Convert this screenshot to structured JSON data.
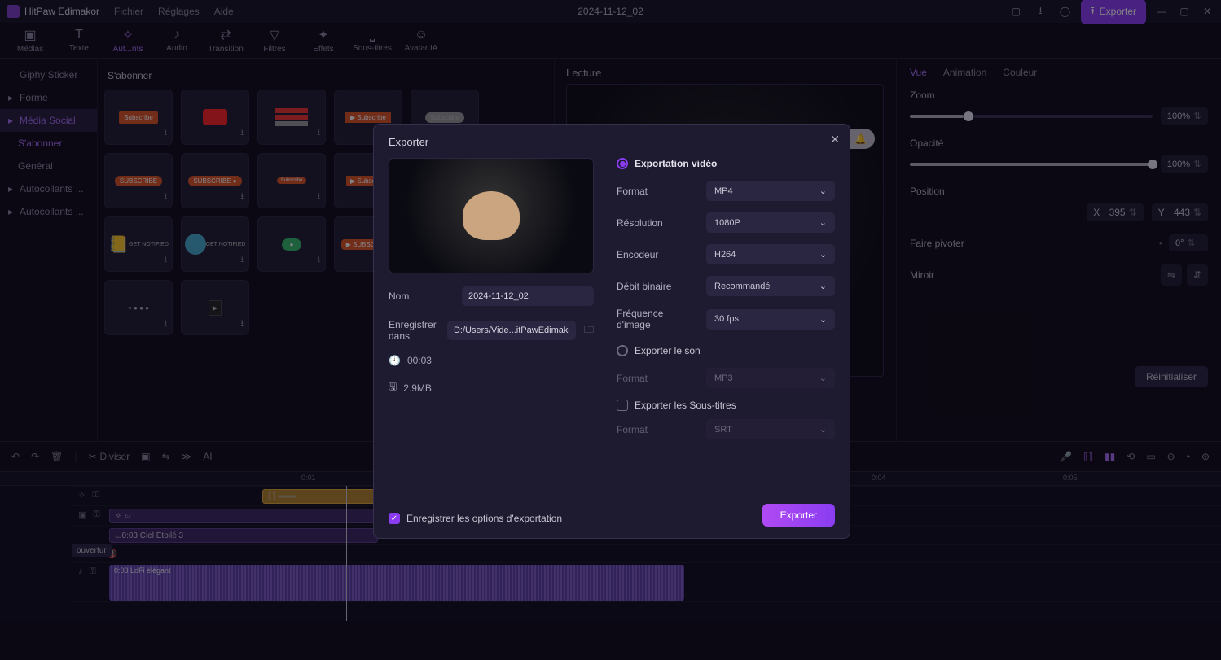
{
  "app": {
    "name": "HitPaw Edimakor",
    "file": "2024-11-12_02",
    "menus": [
      "Fichier",
      "Réglages",
      "Aide"
    ],
    "export_btn": "Exporter"
  },
  "tools": [
    {
      "label": "Médias",
      "active": false
    },
    {
      "label": "Texte",
      "active": false
    },
    {
      "label": "Aut...nts",
      "active": true
    },
    {
      "label": "Audio",
      "active": false
    },
    {
      "label": "Transition",
      "active": false
    },
    {
      "label": "Filtres",
      "active": false
    },
    {
      "label": "Effets",
      "active": false
    },
    {
      "label": "Sous-titres",
      "active": false
    },
    {
      "label": "Avatar IA",
      "active": false
    }
  ],
  "sidebar": {
    "items": [
      {
        "label": "Giphy Sticker",
        "chev": false
      },
      {
        "label": "Forme",
        "chev": true
      },
      {
        "label": "Média Social",
        "chev": true,
        "active": true
      },
      {
        "label": "S'abonner",
        "chev": false,
        "indent": true,
        "active": true
      },
      {
        "label": "Général",
        "chev": false,
        "indent": true
      },
      {
        "label": "Autocollants ...",
        "chev": true
      },
      {
        "label": "Autocollants ...",
        "chev": true
      }
    ],
    "section_title": "S'abonner"
  },
  "preview": {
    "title": "Lecture"
  },
  "right_tabs": [
    {
      "label": "Vue",
      "active": true
    },
    {
      "label": "Animation"
    },
    {
      "label": "Couleur"
    }
  ],
  "props": {
    "zoom": {
      "label": "Zoom",
      "value": "100%",
      "pct": 22
    },
    "opacity": {
      "label": "Opacité",
      "value": "100%",
      "pct": 100
    },
    "position": {
      "label": "Position",
      "x_label": "X",
      "x": "395",
      "y_label": "Y",
      "y": "443"
    },
    "rotate": {
      "label": "Faire pivoter",
      "value": "0°"
    },
    "mirror": {
      "label": "Miroir"
    },
    "reset": "Réinitialiser"
  },
  "tl": {
    "split": "Diviser",
    "ticks": [
      "0:01",
      "0:04",
      "0:05"
    ],
    "clip_label": "0:03 Ciel Étoilé 3",
    "audio_label": "0:03 LoFi élégant",
    "transition": "ouvertur"
  },
  "modal": {
    "title": "Exporter",
    "video_export": "Exportation vidéo",
    "name_label": "Nom",
    "name_value": "2024-11-12_02",
    "save_label": "Enregistrer dans",
    "save_path": "D:/Users/Vide...itPawEdimakor",
    "duration": "00:03",
    "size": "2.9MB",
    "format_label": "Format",
    "format_value": "MP4",
    "res_label": "Résolution",
    "res_value": "1080P",
    "enc_label": "Encodeur",
    "enc_value": "H264",
    "bitrate_label": "Débit binaire",
    "bitrate_value": "Recommandé",
    "fps_label": "Fréquence d'image",
    "fps_value": "30  fps",
    "audio_export": "Exporter le son",
    "audio_format_label": "Format",
    "audio_format_value": "MP3",
    "subtitle_export": "Exporter les Sous-titres",
    "sub_format_label": "Format",
    "sub_format_value": "SRT",
    "save_opts": "Enregistrer les options d'exportation",
    "export_btn": "Exporter"
  }
}
